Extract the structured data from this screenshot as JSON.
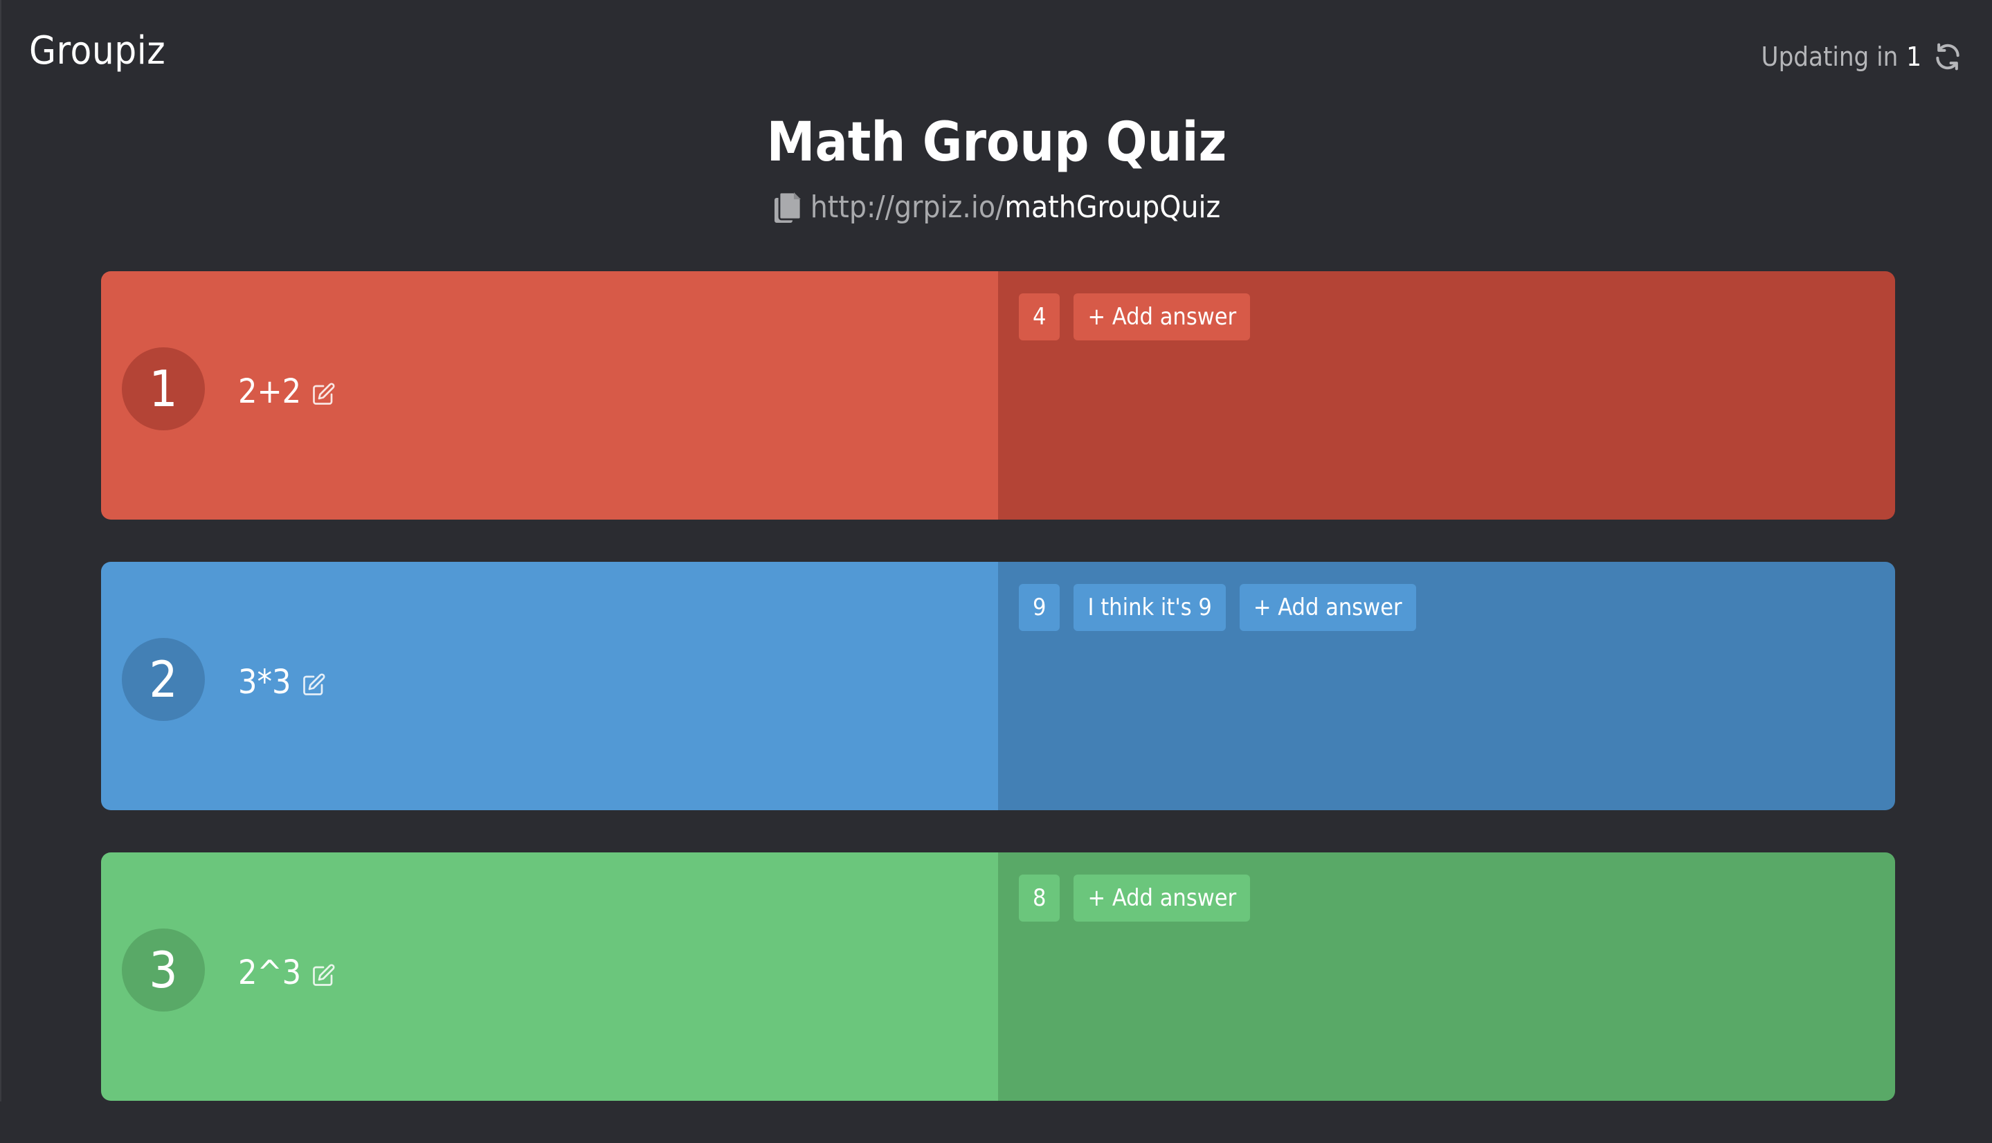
{
  "header": {
    "brand": "Groupiz",
    "updating_label": "Updating in",
    "updating_count": "1",
    "refresh_icon": "refresh-icon"
  },
  "quiz": {
    "title": "Math Group Quiz",
    "url_base": "http://grpiz.io/",
    "url_slug": "mathGroupQuiz",
    "copy_icon": "copy-icon"
  },
  "questions": [
    {
      "number": "1",
      "text": "2+2",
      "color": "#d75a48",
      "answers": [
        "4"
      ],
      "add_label": "+ Add answer"
    },
    {
      "number": "2",
      "text": "3*3",
      "color": "#5299d5",
      "answers": [
        "9",
        "I think it's 9"
      ],
      "add_label": "+ Add answer"
    },
    {
      "number": "3",
      "text": "2^3",
      "color": "#6bc67c",
      "answers": [
        "8"
      ],
      "add_label": "+ Add answer"
    }
  ]
}
